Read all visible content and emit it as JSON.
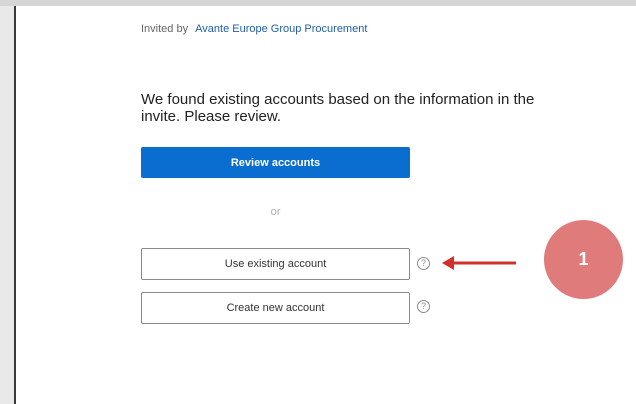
{
  "invite": {
    "prefix": "Invited by",
    "buyer": "Avante Europe Group Procurement"
  },
  "message": "We found existing accounts based on the information in the invite. Please review.",
  "actions": {
    "review_label": "Review accounts",
    "separator": "or",
    "use_existing_label": "Use existing account",
    "create_new_label": "Create new account",
    "help_glyph": "?"
  },
  "annotation": {
    "step_number": "1",
    "arrow_color": "#d0312d",
    "badge_color": "#e07b7b"
  },
  "colors": {
    "primary": "#0a6ed1",
    "link": "#1f5fa8"
  }
}
